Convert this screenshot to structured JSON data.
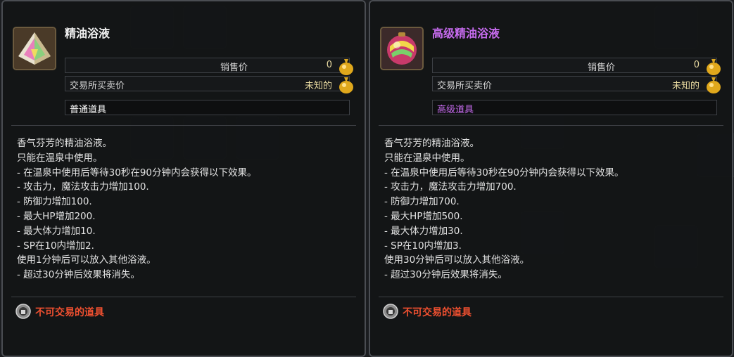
{
  "colors": {
    "normal_grade": "#f2f2f2",
    "high_grade": "#c86cf0",
    "untradeable": "#f05030",
    "price_value": "#e8d9a0"
  },
  "tooltips": [
    {
      "item_name": "精油浴液",
      "icon": "pyramid-crystal-icon",
      "sell_price_label": "销售价",
      "sell_price_value": "0",
      "exchange_label": "交易所买卖价",
      "exchange_value": "未知的",
      "grade": "普通道具",
      "description": [
        "香气芬芳的精油浴液。",
        "只能在温泉中使用。",
        "- 在温泉中使用后等待30秒在90分钟内会获得以下效果。",
        "- 攻击力，魔法攻击力增加100.",
        "- 防御力增加100.",
        "- 最大HP增加200.",
        "- 最大体力增加10.",
        "- SP在10内增加2.",
        "使用1分钟后可以放入其他浴液。",
        "- 超过30分钟后效果将消失。"
      ],
      "trade_notice": "不可交易的道具"
    },
    {
      "item_name": "高级精油浴液",
      "icon": "rainbow-orb-icon",
      "sell_price_label": "销售价",
      "sell_price_value": "0",
      "exchange_label": "交易所买卖价",
      "exchange_value": "未知的",
      "grade": "高级道具",
      "description": [
        "香气芬芳的精油浴液。",
        "只能在温泉中使用。",
        "- 在温泉中使用后等待30秒在90分钟内会获得以下效果。",
        "- 攻击力，魔法攻击力增加700.",
        "- 防御力增加700.",
        "- 最大HP增加500.",
        "- 最大体力增加30.",
        "- SP在10内增加3.",
        "使用30分钟后可以放入其他浴液。",
        "- 超过30分钟后效果将消失。"
      ],
      "trade_notice": "不可交易的道具"
    }
  ]
}
